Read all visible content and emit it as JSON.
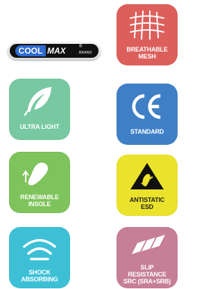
{
  "logo": {
    "cool": "COOL",
    "max": "MAX",
    "reg": "®",
    "brand": "BRAND"
  },
  "tiles": {
    "breathable": {
      "lines": [
        "BREATHABLE",
        "MESH"
      ],
      "color": "#dd5f5c",
      "icon": "mesh-icon"
    },
    "ultralight": {
      "lines": [
        "ULTRA LIGHT"
      ],
      "color": "#78c9a2",
      "icon": "feather-icon"
    },
    "standard": {
      "lines": [
        "STANDARD"
      ],
      "color": "#3f7fc6",
      "icon": "ce-mark-icon"
    },
    "insole": {
      "lines": [
        "RENEWABLE",
        "INSOLE"
      ],
      "color": "#7ec35b",
      "icon": "insole-icon"
    },
    "esd": {
      "lines": [
        "ANTISTATIC",
        "ESD"
      ],
      "color": "#ebe32b",
      "icon": "esd-warning-icon"
    },
    "shock": {
      "lines": [
        "SHOCK",
        "ABSORBING"
      ],
      "color": "#3dc0d6",
      "icon": "shock-waves-icon"
    },
    "slip": {
      "lines": [
        "SLIP",
        "RESISTANCE",
        "SRC (SRA+SRB)"
      ],
      "color": "#c67f97",
      "icon": "slip-arrows-icon"
    }
  }
}
